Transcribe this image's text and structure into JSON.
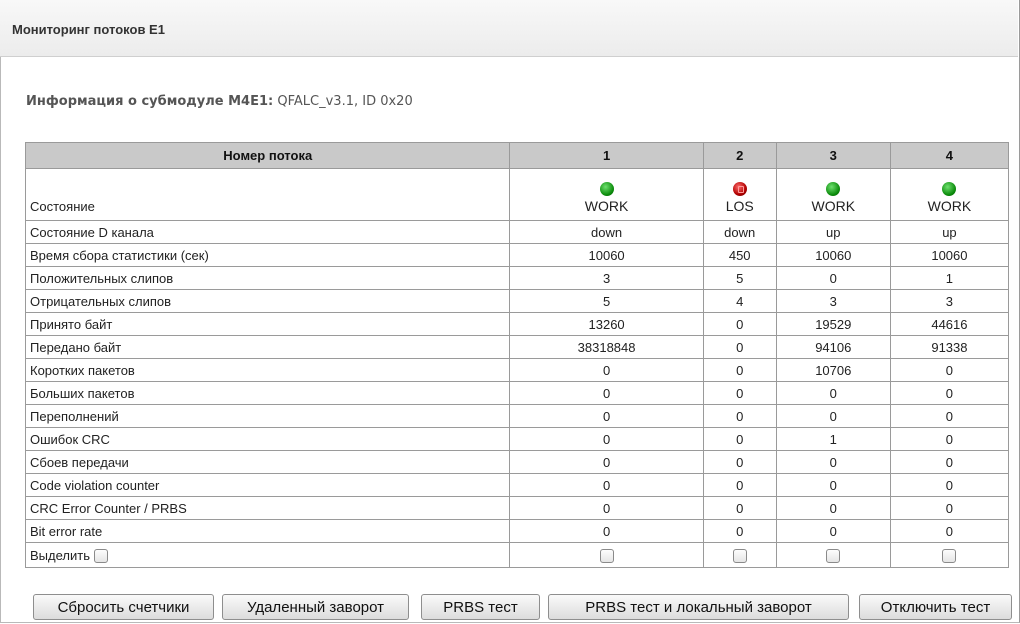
{
  "header": {
    "title": "Мониторинг потоков E1"
  },
  "info": {
    "label": "Информация о субмодуле M4E1",
    "value": "QFALC_v3.1, ID 0x20"
  },
  "table": {
    "header_label": "Номер потока",
    "streams": [
      "1",
      "2",
      "3",
      "4"
    ],
    "state": {
      "label": "Состояние",
      "values": [
        {
          "text": "WORK",
          "led": "green"
        },
        {
          "text": "LOS",
          "led": "red"
        },
        {
          "text": "WORK",
          "led": "green"
        },
        {
          "text": "WORK",
          "led": "green"
        }
      ]
    },
    "rows": [
      {
        "label": "Состояние D канала",
        "values": [
          "down",
          "down",
          "up",
          "up"
        ]
      },
      {
        "label": "Время сбора статистики (сек)",
        "values": [
          "10060",
          "450",
          "10060",
          "10060"
        ]
      },
      {
        "label": "Положительных слипов",
        "values": [
          "3",
          "5",
          "0",
          "1"
        ]
      },
      {
        "label": "Отрицательных слипов",
        "values": [
          "5",
          "4",
          "3",
          "3"
        ]
      },
      {
        "label": "Принято байт",
        "values": [
          "13260",
          "0",
          "19529",
          "44616"
        ]
      },
      {
        "label": "Передано байт",
        "values": [
          "38318848",
          "0",
          "94106",
          "91338"
        ]
      },
      {
        "label": "Коротких пакетов",
        "values": [
          "0",
          "0",
          "10706",
          "0"
        ]
      },
      {
        "label": "Больших пакетов",
        "values": [
          "0",
          "0",
          "0",
          "0"
        ]
      },
      {
        "label": "Переполнений",
        "values": [
          "0",
          "0",
          "0",
          "0"
        ]
      },
      {
        "label": "Ошибок CRC",
        "values": [
          "0",
          "0",
          "1",
          "0"
        ]
      },
      {
        "label": "Сбоев передачи",
        "values": [
          "0",
          "0",
          "0",
          "0"
        ]
      },
      {
        "label": "Code violation counter",
        "values": [
          "0",
          "0",
          "0",
          "0"
        ]
      },
      {
        "label": "CRC Error Counter / PRBS",
        "values": [
          "0",
          "0",
          "0",
          "0"
        ]
      },
      {
        "label": "Bit error rate",
        "values": [
          "0",
          "0",
          "0",
          "0"
        ]
      }
    ],
    "select_label": "Выделить"
  },
  "buttons": {
    "reset": "Сбросить счетчики",
    "remote_loop": "Удаленный заворот",
    "prbs": "PRBS тест",
    "prbs_local": "PRBS тест и локальный заворот",
    "stop": "Отключить тест"
  }
}
